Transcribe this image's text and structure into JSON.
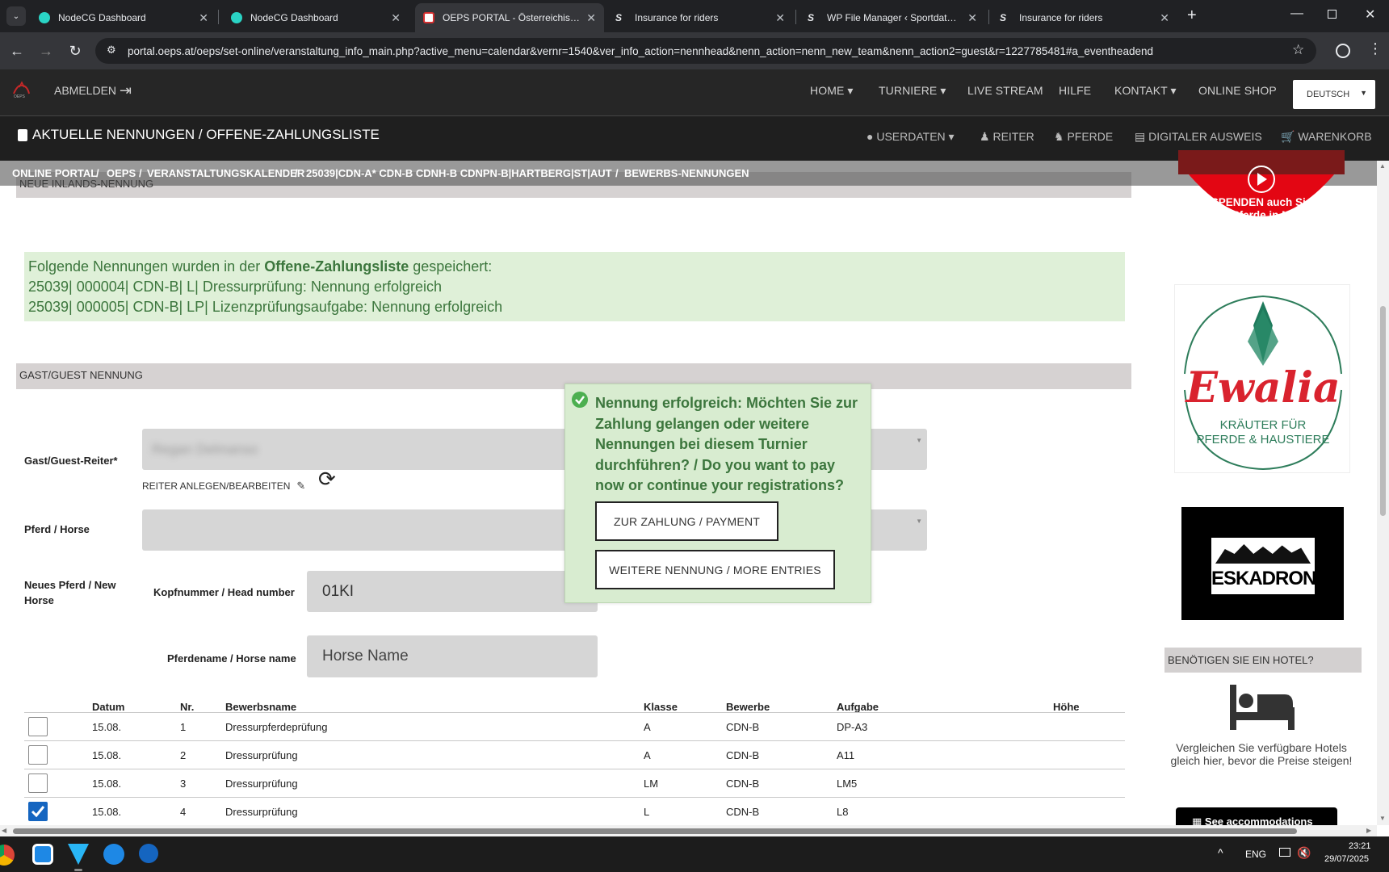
{
  "browser": {
    "tabs": [
      {
        "title": "NodeCG Dashboard"
      },
      {
        "title": "NodeCG Dashboard"
      },
      {
        "title": "OEPS PORTAL - Österreichischer Pferdesportverband"
      },
      {
        "title": "Insurance for riders"
      },
      {
        "title": "WP File Manager ‹ Sportdata — WordPress"
      },
      {
        "title": "Insurance for riders"
      }
    ],
    "url": "portal.oeps.at/oeps/set-online/veranstaltung_info_main.php?active_menu=calendar&vernr=1540&ver_info_action=nennhead&nenn_action=nenn_new_team&nenn_action2=guest&r=1227785481#a_eventheadend"
  },
  "site_nav": {
    "logout": "ABMELDEN",
    "items": [
      "HOME",
      "TURNIERE",
      "LIVE STREAM",
      "HILFE",
      "KONTAKT",
      "ONLINE SHOP"
    ],
    "language": "DEUTSCH"
  },
  "sub_nav": {
    "title": "AKTUELLE NENNUNGEN / OFFENE-ZAHLUNGSLISTE",
    "items": [
      "USERDATEN",
      "REITER",
      "PFERDE",
      "DIGITALER AUSWEIS",
      "WARENKORB"
    ]
  },
  "breadcrumb": [
    "ONLINE PORTAL",
    "OEPS",
    "VERANSTALTUNGSKALENDER",
    "25039|CDN-A* CDN-B CDNH-B CDNPN-B|HARTBERG|ST|AUT",
    "BEWERBS-NENNUNGEN"
  ],
  "section_inland": "NEUE INLANDS-NENNUNG",
  "success": {
    "intro": "Folgende Nennungen wurden in der ",
    "list_name": "Offene-Zahlungsliste",
    "outro": " gespeichert:",
    "line1": "25039| 000004| CDN-B| L| Dressurprüfung: Nennung erfolgreich",
    "line2": "25039| 000005| CDN-B| LP| Lizenzprüfungsaufgabe: Nennung erfolgreich"
  },
  "section_guest": "GAST/GUEST NENNUNG",
  "form": {
    "rider_label": "Gast/Guest-Reiter*",
    "rider_value": "Regan Delmanso",
    "rider_link": "REITER ANLEGEN/BEARBEITEN",
    "horse_label": "Pferd / Horse",
    "new_horse_label": "Neues Pferd / New Horse",
    "head_number_label": "Kopfnummer / Head number",
    "head_number_value": "01KI",
    "horse_name_label": "Pferdename / Horse name",
    "horse_name_placeholder": "Horse Name"
  },
  "table": {
    "headers": [
      "Datum",
      "Nr.",
      "Bewerbsname",
      "Klasse",
      "Bewerbe",
      "Aufgabe",
      "Höhe"
    ],
    "rows": [
      {
        "checked": false,
        "datum": "15.08.",
        "nr": "1",
        "name": "Dressurpferdeprüfung",
        "klasse": "A",
        "bewerbe": "CDN-B",
        "aufgabe": "DP-A3"
      },
      {
        "checked": false,
        "datum": "15.08.",
        "nr": "2",
        "name": "Dressurprüfung",
        "klasse": "A",
        "bewerbe": "CDN-B",
        "aufgabe": "A11"
      },
      {
        "checked": false,
        "datum": "15.08.",
        "nr": "3",
        "name": "Dressurprüfung",
        "klasse": "LM",
        "bewerbe": "CDN-B",
        "aufgabe": "LM5"
      },
      {
        "checked": true,
        "datum": "15.08.",
        "nr": "4",
        "name": "Dressurprüfung",
        "klasse": "L",
        "bewerbe": "CDN-B",
        "aufgabe": "L8"
      }
    ]
  },
  "modal": {
    "message": "Nennung erfolgreich: Möchten Sie zur Zahlung gelangen oder weitere Nennungen bei diesem Turnier durchführen? / Do you want to pay now or continue your registrations?",
    "pay_button": "ZUR ZAHLUNG / PAYMENT",
    "more_button": "WEITERE NENNUNG / MORE ENTRIES"
  },
  "sidebar": {
    "donate": "SPENDEN auch Sie für Pferde in NOT!",
    "ewalia_name": "Ewalia",
    "ewalia_tagline1": "KRÄUTER FÜR",
    "ewalia_tagline2": "PFERDE & HAUSTIERE",
    "eskadron": "ESKADRON",
    "hotel_heading": "BENÖTIGEN SIE EIN HOTEL?",
    "hotel_text": "Vergleichen Sie verfügbare Hotels gleich hier, bevor die Preise steigen!",
    "hotel_button": "See accommodations"
  },
  "taskbar": {
    "language": "ENG",
    "time": "23:21",
    "date": "29/07/2025"
  },
  "colors": {
    "success_bg": "#dff0d8",
    "success_text": "#3c763d",
    "nav_bg": "#262626",
    "ewalia_red": "#d9232e",
    "ewalia_green": "#2e7d5b",
    "donate_red": "#e30613"
  }
}
